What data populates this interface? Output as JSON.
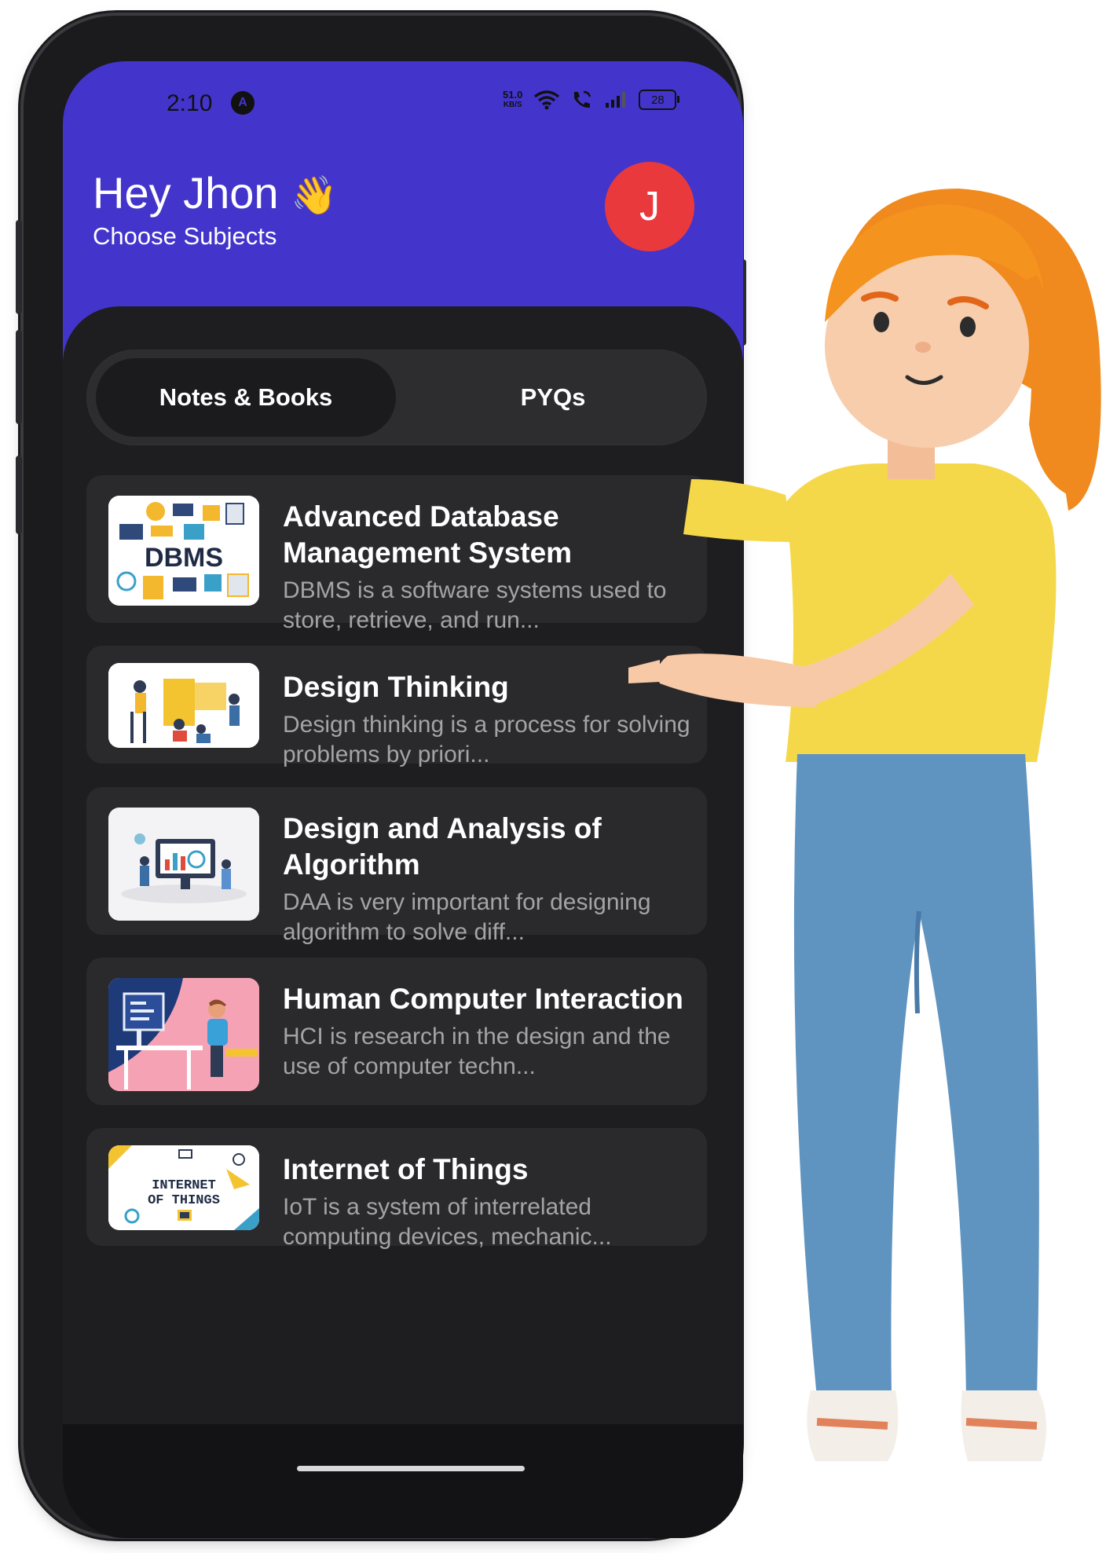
{
  "status_bar": {
    "time": "2:10",
    "a_badge": "A",
    "net_speed_value": "51.0",
    "net_speed_unit": "KB/S",
    "battery": "28"
  },
  "header": {
    "greeting": "Hey Jhon",
    "wave_emoji": "👋",
    "subtitle": "Choose Subjects",
    "avatar_initial": "J"
  },
  "tabs": [
    {
      "label": "Notes & Books",
      "active": true
    },
    {
      "label": "PYQs",
      "active": false
    }
  ],
  "subjects": [
    {
      "title": "Advanced Database Management System",
      "description": "DBMS is a software systems used to store, retrieve, and run...",
      "thumbnail_label": "DBMS"
    },
    {
      "title": "Design Thinking",
      "description": "Design thinking is a process for solving problems by priori..."
    },
    {
      "title": "Design and Analysis of Algorithm",
      "description": "DAA is very important for designing algorithm to solve diff..."
    },
    {
      "title": "Human Computer Interaction",
      "description": "HCI is research in the design and the use of computer techn..."
    },
    {
      "title": "Internet of Things",
      "description": "IoT is a system of interrelated computing devices, mechanic...",
      "thumbnail_label_line1": "INTERNET",
      "thumbnail_label_line2": "OF THINGS"
    }
  ],
  "colors": {
    "header_bg": "#4335cb",
    "avatar_bg": "#e9393c",
    "content_bg": "#1e1e21",
    "card_bg": "#2a2a2d"
  }
}
